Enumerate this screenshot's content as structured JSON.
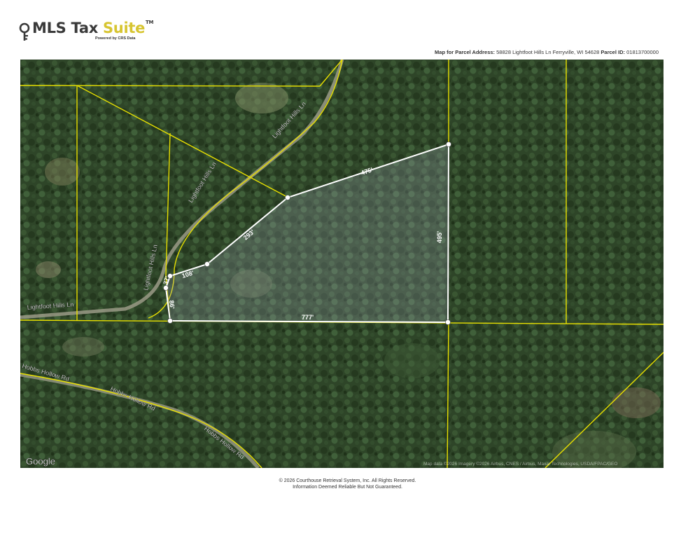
{
  "logo": {
    "brand": "MLS Tax ",
    "brand_accent": "Suite",
    "trademark": "TM",
    "powered_by": "Powered by CRS Data"
  },
  "header": {
    "address_label": "Map for Parcel Address:",
    "address_value": "58828 Lightfoot Hills Ln Ferryville, WI 54628",
    "parcel_label": "Parcel ID:",
    "parcel_value": "01813700000"
  },
  "map": {
    "provider_logo": "Google",
    "attribution": "Map data ©2026 Imagery ©2026 Airbus, CNES / Airbus, Maxar Technologies, USDA/FPAC/GEO",
    "colors": {
      "parcel_lines": "#e8e000",
      "subject_outline": "#ffffff",
      "imagery_base": "#2d4326"
    },
    "roads": [
      "Lightfoot Hills Ln",
      "Lightfoot Hills Ln",
      "Lightfoot Hills Ln",
      "Lightfoot Hills Ln",
      "Hobbs Hollow Rd",
      "Hobbs Hollow Rd",
      "Hobbs Hollow Rd"
    ],
    "dimensions": [
      "475'",
      "495'",
      "293'",
      "108'",
      "37'",
      "86'",
      "777'"
    ]
  },
  "footer": {
    "copyright": "© 2026 Courthouse Retrieval System, Inc. All Rights Reserved.",
    "disclaimer": "Information Deemed Reliable But Not Guaranteed."
  }
}
